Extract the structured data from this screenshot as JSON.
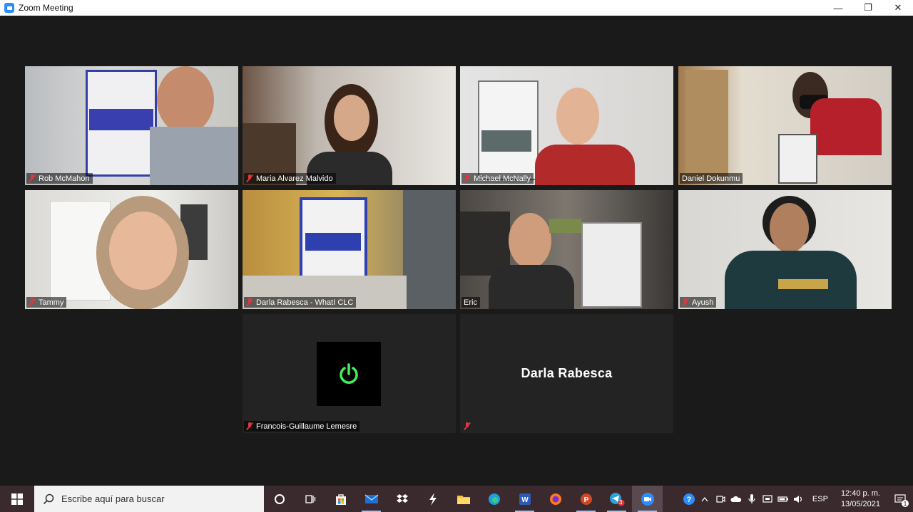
{
  "window": {
    "title": "Zoom Meeting",
    "controls": {
      "minimize": "—",
      "maximize": "❐",
      "close": "✕"
    }
  },
  "participants": [
    {
      "name": "Rob McMahon",
      "muted": true
    },
    {
      "name": "Maria Alvarez Malvido",
      "muted": true
    },
    {
      "name": "Michael McNally",
      "muted": true
    },
    {
      "name": "Daniel Dokunmu",
      "muted": false
    },
    {
      "name": "Tammy",
      "muted": true
    },
    {
      "name": "Darla Rabesca - WhatI CLC",
      "muted": true
    },
    {
      "name": "Eric",
      "muted": true,
      "active_speaker": true
    },
    {
      "name": "Ayush",
      "muted": true
    },
    {
      "name": "Francois-Guillaume Lemesre",
      "muted": true,
      "video_off": true,
      "avatar_icon": "power-icon"
    },
    {
      "name": "",
      "display_name": "Darla Rabesca",
      "muted": true,
      "video_off": true
    }
  ],
  "taskbar": {
    "search_placeholder": "Escribe aquí para buscar",
    "apps": [
      "cortana",
      "task-view",
      "store",
      "mail",
      "dropbox",
      "power-automate",
      "file-explorer",
      "edge",
      "word",
      "firefox",
      "powerpoint",
      "telegram",
      "zoom"
    ],
    "telegram_badge": "3",
    "language": "ESP",
    "time": "12:40 p. m.",
    "date": "13/05/2021",
    "notification_count": "1"
  },
  "colors": {
    "active_speaker_border": "#d6e35a",
    "mute_red": "#e0373f",
    "power_green": "#3ff05a",
    "taskbar": "#3a2a2e"
  }
}
